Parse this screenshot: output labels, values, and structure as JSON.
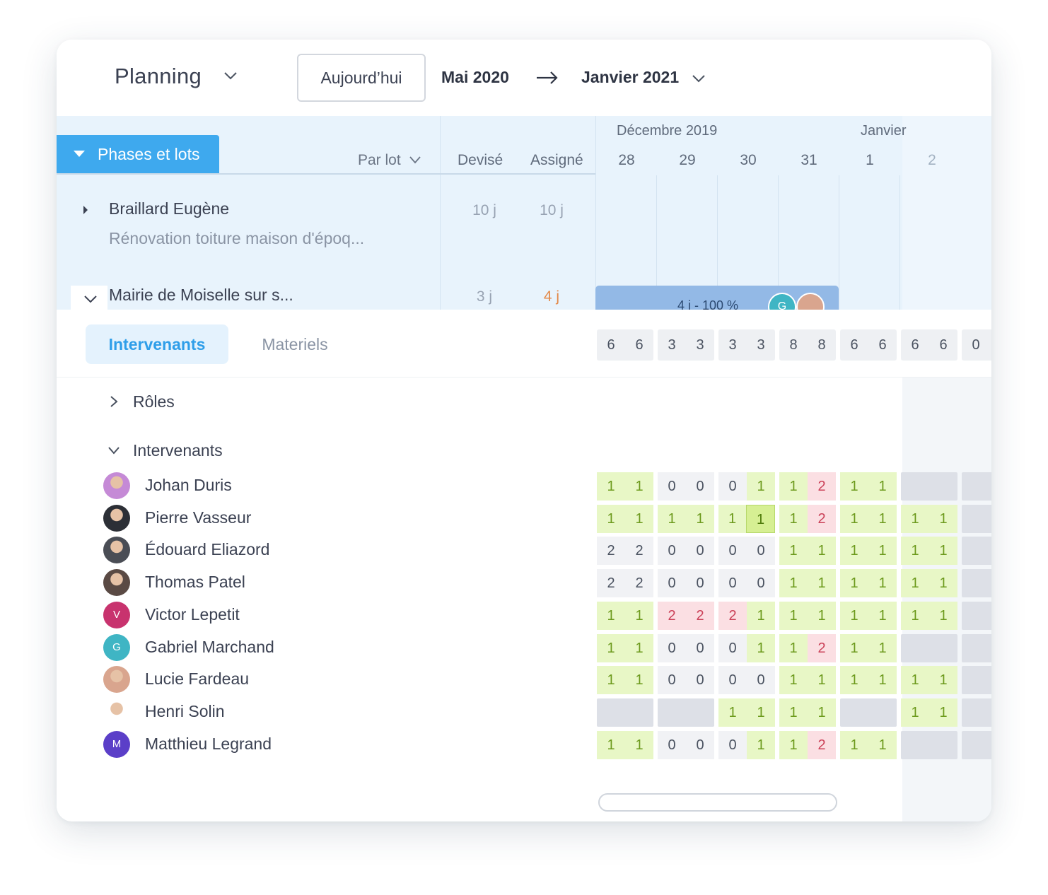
{
  "toolbar": {
    "title": "Planning",
    "today_label": "Aujourd’hui",
    "range_start": "Mai 2020",
    "range_end": "Janvier 2021"
  },
  "table_header": {
    "phases_tab": "Phases et lots",
    "group_by": "Par lot",
    "col_devise": "Devisé",
    "col_assigne": "Assigné",
    "months": [
      "Décembre 2019",
      "Janvier"
    ],
    "days": [
      "28",
      "29",
      "30",
      "31",
      "1",
      "2",
      ""
    ]
  },
  "rows": [
    {
      "name": "Braillard Eugène",
      "subtitle": "Rénovation toiture maison d'époq...",
      "devise": "10 j",
      "assigne": "10 j"
    },
    {
      "name": "Mairie de Moiselle sur s...",
      "devise": "3 j",
      "assigne": "4 j",
      "bar_label": "4 j - 100 %",
      "bar_avatar_initial": "G"
    }
  ],
  "tabs": {
    "active": "Intervenants",
    "inactive": "Materiels"
  },
  "summary_row": [
    [
      "6",
      "6"
    ],
    [
      "3",
      "3"
    ],
    [
      "3",
      "3"
    ],
    [
      "8",
      "8"
    ],
    [
      "6",
      "6"
    ],
    [
      "6",
      "6"
    ],
    [
      "0",
      ""
    ]
  ],
  "groups": {
    "roles": "Rôles",
    "intervenants": "Intervenants"
  },
  "people": [
    {
      "name": "Johan Duris",
      "avatar": "photo",
      "avatar_color": "#c58ad6",
      "cells": [
        [
          "g1",
          "g1"
        ],
        [
          "z0",
          "z0"
        ],
        [
          "z0",
          "g1"
        ],
        [
          "g1",
          "r2"
        ],
        [
          "g1",
          "g1"
        ],
        [
          "block"
        ],
        [
          "block"
        ]
      ]
    },
    {
      "name": "Pierre Vasseur",
      "avatar": "photo",
      "avatar_color": "#2c2f36",
      "cells": [
        [
          "g1",
          "g1"
        ],
        [
          "g1",
          "g1"
        ],
        [
          "g1",
          "gs1"
        ],
        [
          "g1",
          "r2"
        ],
        [
          "g1",
          "g1"
        ],
        [
          "g1",
          "g1"
        ],
        [
          "block"
        ]
      ]
    },
    {
      "name": "Édouard Eliazord",
      "avatar": "photo",
      "avatar_color": "#4a4d55",
      "cells": [
        [
          "n2",
          "n2"
        ],
        [
          "z0",
          "z0"
        ],
        [
          "z0",
          "z0"
        ],
        [
          "g1",
          "g1"
        ],
        [
          "g1",
          "g1"
        ],
        [
          "g1",
          "g1"
        ],
        [
          "block"
        ]
      ]
    },
    {
      "name": "Thomas Patel",
      "avatar": "photo",
      "avatar_color": "#5a4a44",
      "cells": [
        [
          "n2",
          "n2"
        ],
        [
          "z0",
          "z0"
        ],
        [
          "z0",
          "z0"
        ],
        [
          "g1",
          "g1"
        ],
        [
          "g1",
          "g1"
        ],
        [
          "g1",
          "g1"
        ],
        [
          "block"
        ]
      ]
    },
    {
      "name": "Victor Lepetit",
      "avatar": "initial",
      "initial": "V",
      "avatar_color": "#c8336e",
      "cells": [
        [
          "g1",
          "g1"
        ],
        [
          "r2",
          "r2"
        ],
        [
          "r2",
          "g1"
        ],
        [
          "g1",
          "g1"
        ],
        [
          "g1",
          "g1"
        ],
        [
          "g1",
          "g1"
        ],
        [
          "block"
        ]
      ]
    },
    {
      "name": "Gabriel Marchand",
      "avatar": "initial",
      "initial": "G",
      "avatar_color": "#3fb5c4",
      "cells": [
        [
          "g1",
          "g1"
        ],
        [
          "z0",
          "z0"
        ],
        [
          "z0",
          "g1"
        ],
        [
          "g1",
          "r2"
        ],
        [
          "g1",
          "g1"
        ],
        [
          "block"
        ],
        [
          "block"
        ]
      ]
    },
    {
      "name": "Lucie Fardeau",
      "avatar": "photo",
      "avatar_color": "#d9a58e",
      "cells": [
        [
          "g1",
          "g1"
        ],
        [
          "z0",
          "z0"
        ],
        [
          "z0",
          "z0"
        ],
        [
          "g1",
          "g1"
        ],
        [
          "g1",
          "g1"
        ],
        [
          "g1",
          "g1"
        ],
        [
          "block"
        ]
      ]
    },
    {
      "name": "Henri Solin",
      "avatar": "photo",
      "avatar_color": "#ffffff",
      "cells": [
        [
          "block"
        ],
        [
          "block"
        ],
        [
          "g1",
          "g1"
        ],
        [
          "g1",
          "g1"
        ],
        [
          "block"
        ],
        [
          "g1",
          "g1"
        ],
        [
          "block"
        ]
      ]
    },
    {
      "name": "Matthieu Legrand",
      "avatar": "initial",
      "initial": "M",
      "avatar_color": "#5b3fc8",
      "cells": [
        [
          "g1",
          "g1"
        ],
        [
          "z0",
          "z0"
        ],
        [
          "z0",
          "g1"
        ],
        [
          "g1",
          "r2"
        ],
        [
          "g1",
          "g1"
        ],
        [
          "block"
        ],
        [
          "block"
        ]
      ]
    }
  ],
  "colors": {
    "accent": "#3ea9ee",
    "header_bg": "#e8f3fc",
    "available": "#e8f7c6",
    "overbooked": "#fbdfe3",
    "gantt_bar": "#93b9e6"
  },
  "icons": {
    "title_dropdown": "chevron-down-icon",
    "range_arrow": "arrow-right-icon",
    "collapse": "triangle-down-icon",
    "row_expand": "triangle-right-icon"
  }
}
